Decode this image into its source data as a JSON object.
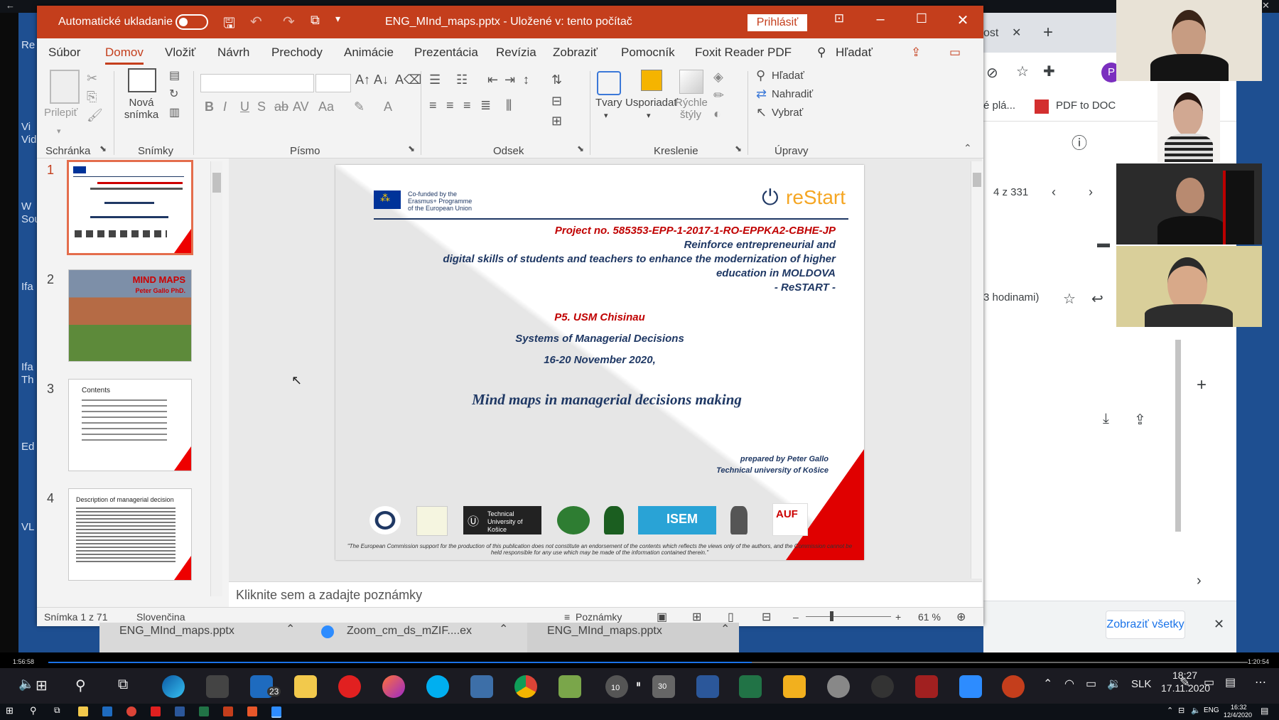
{
  "desktop": {
    "left_labels": [
      "Re",
      "Vi",
      "Vid",
      "W",
      "Sou",
      "Ifa",
      "Ifa",
      "Th",
      "Ed",
      "VL"
    ]
  },
  "chrome": {
    "tab_text": "ost",
    "bookmark_1": "é plá...",
    "bookmark_2": "PDF to DOC",
    "page_counter": "4 z 331",
    "time_ago": "3 hodinami)",
    "show_all": "Zobraziť všetky"
  },
  "ppt": {
    "autosave_label": "Automatické ukladanie",
    "doc_title": "ENG_MInd_maps.pptx  -  Uložené v: tento počítač",
    "signin": "Prihlásiť",
    "menu": [
      "Súbor",
      "Domov",
      "Vložiť",
      "Návrh",
      "Prechody",
      "Animácie",
      "Prezentácia",
      "Revízia",
      "Zobraziť",
      "Pomocník",
      "Foxit Reader PDF"
    ],
    "search": "Hľadať",
    "ribbon": {
      "paste": "Prilepiť",
      "new_slide": "Nová snímka",
      "shapes": "Tvary",
      "arrange": "Usporiadať",
      "quick_styles": "Rýchle štýly",
      "find": "Hľadať",
      "replace": "Nahradiť",
      "select": "Vybrať",
      "groups": [
        "Schránka",
        "Snímky",
        "Písmo",
        "Odsek",
        "Kreslenie",
        "Úpravy"
      ]
    },
    "thumbs": [
      {
        "num": "1"
      },
      {
        "num": "2",
        "title": "MIND MAPS",
        "subtitle": "Peter Gallo PhD."
      },
      {
        "num": "3",
        "title": "Contents"
      },
      {
        "num": "4",
        "title": "Description of managerial decision"
      }
    ],
    "slide": {
      "eu_text": "Co-funded by the Erasmus+ Programme of the European Union",
      "brand": "reStart",
      "project": "Project no. 585353-EPP-1-2017-1-RO-EPPKA2-CBHE-JP",
      "line1": "Reinforce entrepreneurial and",
      "line2": "digital skills of students and teachers to enhance the modernization of higher",
      "line3": "education in MOLDOVA",
      "line4": "- ReSTART -",
      "p5": "P5. USM Chisinau",
      "course": "Systems of Managerial Decisions",
      "dates": "16-20 November 2020,",
      "title": "Mind maps in managerial decisions making",
      "prepared": "prepared by Peter Gallo",
      "university": "Technical university of Košice",
      "tuke_logo": "Technical University of Košice",
      "isem_logo": "ISEM",
      "auf_logo": "AUF",
      "disclaimer": "\"The European Commission support for the production of this publication does not constitute an endorsement of the contents which reflects the views only of the authors, and the Commission cannot be held responsible for any use which may be made of the information contained therein.\""
    },
    "notes_placeholder": "Kliknite sem a zadajte poznámky",
    "status": {
      "slide_count": "Snímka 1 z 71",
      "language": "Slovenčina",
      "notes_btn": "Poznámky",
      "zoom": "61 %"
    }
  },
  "downloads": [
    "ENG_MInd_maps.pptx",
    "Zoom_cm_ds_mZIF....ex",
    "ENG_MInd_maps.pptx"
  ],
  "media": {
    "elapsed": "1:56:58",
    "total": "1:20:54"
  },
  "taskbar": {
    "badge_mail": "23",
    "badge_a": "10",
    "badge_b": "30",
    "lang": "SLK",
    "time": "18:27",
    "date": "17.11.2020",
    "tray_lang": "ENG",
    "clock2_time": "16:32",
    "clock2_date": "12/4/2020"
  },
  "colors": {
    "ppt_accent": "#c43e1c",
    "desktop": "#1e4f91"
  }
}
